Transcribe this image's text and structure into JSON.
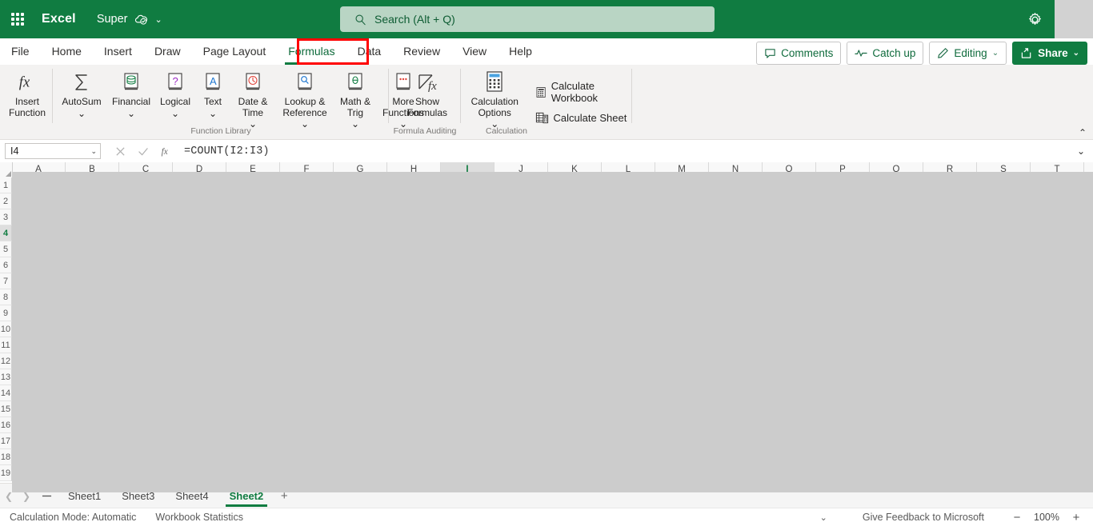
{
  "titlebar": {
    "app_name": "Excel",
    "document_name": "Super",
    "waffle_icon": "app-launcher-icon",
    "cloud_icon": "cloud-saved-icon",
    "chevron_icon": "chevron-down-icon",
    "settings_icon": "gear-icon",
    "brand_color": "#107c41"
  },
  "search": {
    "placeholder": "Search (Alt + Q)",
    "icon": "search-icon",
    "value": ""
  },
  "tabs": [
    {
      "label": "File",
      "active": false
    },
    {
      "label": "Home",
      "active": false
    },
    {
      "label": "Insert",
      "active": false
    },
    {
      "label": "Draw",
      "active": false
    },
    {
      "label": "Page Layout",
      "active": false
    },
    {
      "label": "Formulas",
      "active": true
    },
    {
      "label": "Data",
      "active": false
    },
    {
      "label": "Review",
      "active": false
    },
    {
      "label": "View",
      "active": false
    },
    {
      "label": "Help",
      "active": false
    }
  ],
  "highlight": {
    "target": "Formulas",
    "color": "#ff0000"
  },
  "tab_actions": [
    {
      "label": "Comments",
      "icon": "comment-icon",
      "chevron": false,
      "primary": false
    },
    {
      "label": "Catch up",
      "icon": "catchup-icon",
      "chevron": false,
      "primary": false
    },
    {
      "label": "Editing",
      "icon": "pencil-icon",
      "chevron": true,
      "primary": false
    },
    {
      "label": "Share",
      "icon": "share-icon",
      "chevron": true,
      "primary": true
    }
  ],
  "ribbon": {
    "collapse_icon": "chevron-up-icon",
    "groups": [
      {
        "name": "Insert Function",
        "label": "",
        "items": [
          {
            "label": "Insert Function",
            "icon": "fx-icon",
            "chevron": false
          }
        ]
      },
      {
        "name": "Function Library",
        "label": "Function Library",
        "items": [
          {
            "label": "AutoSum",
            "icon": "sigma-icon",
            "chevron": true
          },
          {
            "label": "Financial",
            "icon": "financial-book-icon",
            "chevron": true
          },
          {
            "label": "Logical",
            "icon": "logical-book-icon",
            "chevron": true
          },
          {
            "label": "Text",
            "icon": "text-book-icon",
            "chevron": true
          },
          {
            "label": "Date & Time",
            "icon": "clock-book-icon",
            "chevron": true
          },
          {
            "label": "Lookup & Reference",
            "icon": "lookup-book-icon",
            "chevron": true
          },
          {
            "label": "Math & Trig",
            "icon": "math-book-icon",
            "chevron": true
          },
          {
            "label": "More Functions",
            "icon": "more-functions-book-icon",
            "chevron": true
          }
        ]
      },
      {
        "name": "Formula Auditing",
        "label": "Formula Auditing",
        "items": [
          {
            "label": "Show Formulas",
            "icon": "show-formulas-icon",
            "chevron": false
          }
        ]
      },
      {
        "name": "Calculation",
        "label": "Calculation",
        "items": [
          {
            "label": "Calculation Options",
            "icon": "calculator-icon",
            "chevron": true
          }
        ],
        "small_items": [
          {
            "label": "Calculate Workbook",
            "icon": "calculate-workbook-icon"
          },
          {
            "label": "Calculate Sheet",
            "icon": "calculate-sheet-icon"
          }
        ]
      }
    ]
  },
  "formula_bar": {
    "name_box_value": "I4",
    "name_box_chevron": "chevron-down-icon",
    "cancel_icon": "cancel-icon",
    "enter_icon": "confirm-icon",
    "function_icon": "fx-icon",
    "formula_value": "=COUNT(I2:I3)",
    "expand_icon": "chevron-down-icon"
  },
  "grid": {
    "columns": [
      "A",
      "B",
      "C",
      "D",
      "E",
      "F",
      "G",
      "H",
      "I",
      "J",
      "K",
      "L",
      "M",
      "N",
      "O",
      "P",
      "Q",
      "R",
      "S",
      "T"
    ],
    "rows": [
      "1",
      "2",
      "3",
      "4",
      "5",
      "6",
      "7",
      "8",
      "9",
      "10",
      "11",
      "12",
      "13",
      "14",
      "15",
      "16",
      "17",
      "18",
      "19"
    ],
    "selected_column": "I",
    "selected_row": "4",
    "select_all_icon": "select-all-corner-icon"
  },
  "sheet_bar": {
    "prev_icon": "chevron-left-icon",
    "next_icon": "chevron-right-icon",
    "menu_icon": "sheet-list-icon",
    "add_icon": "add-sheet-icon",
    "tabs": [
      {
        "label": "Sheet1",
        "active": false
      },
      {
        "label": "Sheet3",
        "active": false
      },
      {
        "label": "Sheet4",
        "active": false
      },
      {
        "label": "Sheet2",
        "active": true
      }
    ]
  },
  "status_bar": {
    "calculation_mode": "Calculation Mode: Automatic",
    "workbook_statistics": "Workbook Statistics",
    "options_chevron": "chevron-down-icon",
    "feedback": "Give Feedback to Microsoft",
    "zoom_out": "−",
    "zoom_level": "100%",
    "zoom_in": "+"
  }
}
